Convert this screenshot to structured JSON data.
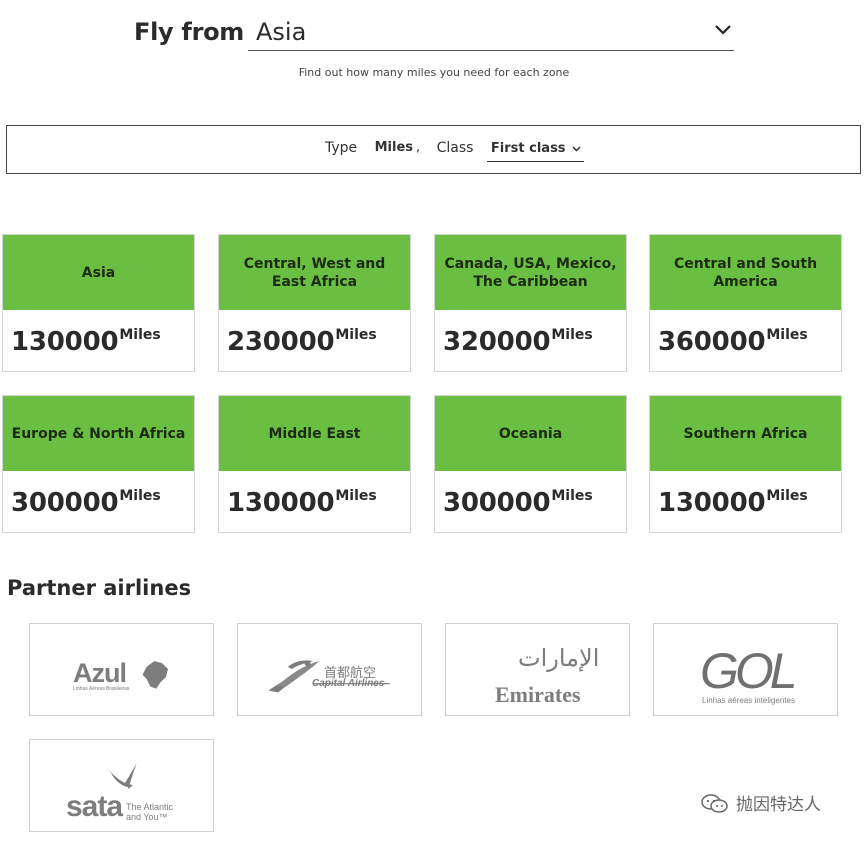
{
  "header": {
    "fly_from_label": "Fly from",
    "region_selected": "Asia",
    "subtitle": "Find out how many miles you need for each zone"
  },
  "filter": {
    "type_label": "Type",
    "type_value": "Miles",
    "separator": ",",
    "class_label": "Class",
    "class_selected": "First class"
  },
  "zones": [
    {
      "name": "Asia",
      "miles": "130000",
      "unit": "Miles"
    },
    {
      "name": "Central, West and East Africa",
      "miles": "230000",
      "unit": "Miles"
    },
    {
      "name": "Canada, USA, Mexico, The Caribbean",
      "miles": "320000",
      "unit": "Miles"
    },
    {
      "name": "Central and South America",
      "miles": "360000",
      "unit": "Miles"
    },
    {
      "name": "Europe & North Africa",
      "miles": "300000",
      "unit": "Miles"
    },
    {
      "name": "Middle East",
      "miles": "130000",
      "unit": "Miles"
    },
    {
      "name": "Oceania",
      "miles": "300000",
      "unit": "Miles"
    },
    {
      "name": "Southern Africa",
      "miles": "130000",
      "unit": "Miles"
    }
  ],
  "partners": {
    "title": "Partner airlines",
    "airlines": [
      {
        "name": "Azul",
        "tagline": "Linhas Aéreas Brasileiras",
        "icon": "brazil-map-icon"
      },
      {
        "name": "Capital Airlines",
        "name_cn": "首都航空",
        "icon": "dragon-icon"
      },
      {
        "name": "Emirates",
        "name_ar": "الإمارات",
        "icon": "emirates-calligraphy-icon"
      },
      {
        "name": "GOL",
        "tagline": "Linhas aéreas inteligentes",
        "icon": "gol-logo-icon"
      },
      {
        "name": "sata",
        "tagline1": "The Atlantic",
        "tagline2": "and You™",
        "icon": "bird-icon"
      }
    ]
  },
  "watermark": {
    "text": "抛因特达人",
    "icon": "wechat-icon"
  },
  "colors": {
    "zone_header_bg": "#6abf43",
    "text_dark": "#2b2b2b",
    "logo_gray": "#7d7d7d"
  }
}
